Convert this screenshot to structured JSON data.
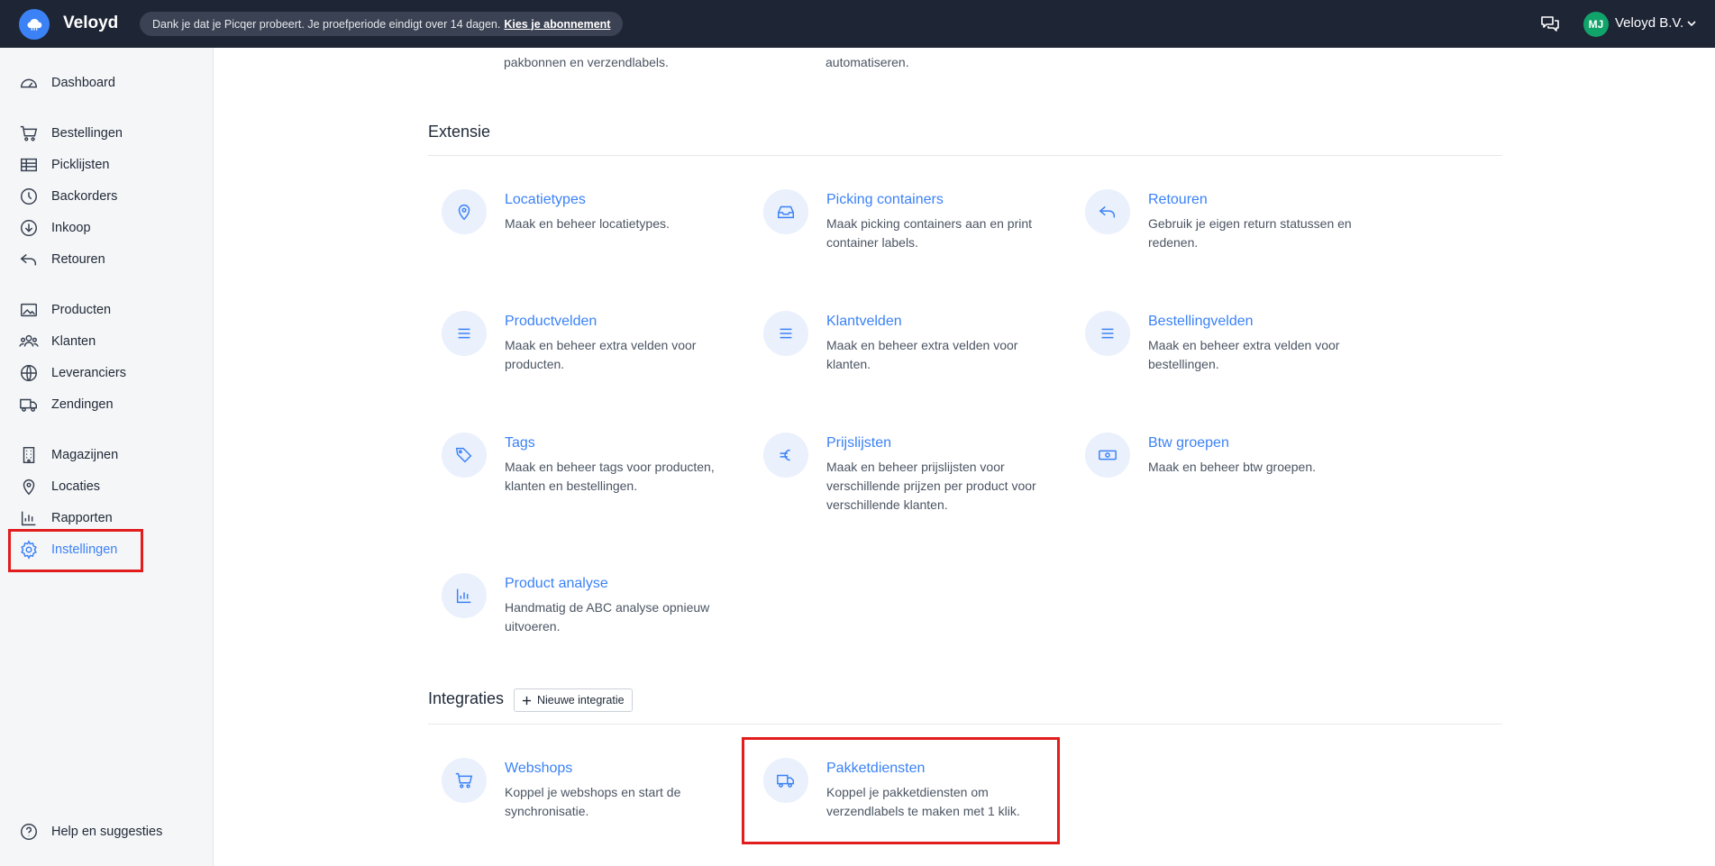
{
  "topbar": {
    "brand": "Veloyd",
    "trial_text": "Dank je dat je Picqer probeert. Je proefperiode eindigt over 14 dagen.",
    "trial_link": "Kies je abonnement",
    "avatar_initials": "MJ",
    "company": "Veloyd B.V."
  },
  "sidebar": {
    "items": [
      {
        "label": "Dashboard",
        "icon": "dashboard-icon"
      },
      {
        "label": "Bestellingen",
        "icon": "cart-icon"
      },
      {
        "label": "Picklijsten",
        "icon": "table-icon"
      },
      {
        "label": "Backorders",
        "icon": "clock-icon"
      },
      {
        "label": "Inkoop",
        "icon": "download-circle-icon"
      },
      {
        "label": "Retouren",
        "icon": "return-icon"
      },
      {
        "label": "Producten",
        "icon": "image-icon"
      },
      {
        "label": "Klanten",
        "icon": "users-icon"
      },
      {
        "label": "Leveranciers",
        "icon": "globe-icon"
      },
      {
        "label": "Zendingen",
        "icon": "truck-icon"
      },
      {
        "label": "Magazijnen",
        "icon": "building-icon"
      },
      {
        "label": "Locaties",
        "icon": "map-pin-icon"
      },
      {
        "label": "Rapporten",
        "icon": "bar-chart-icon"
      },
      {
        "label": "Instellingen",
        "icon": "gear-icon",
        "active": true
      }
    ],
    "help": "Help en suggesties"
  },
  "top_partial": {
    "col1": [
      "pakbonnen en verzendlabels."
    ],
    "col2": [
      "automatiseren."
    ]
  },
  "extensie": {
    "title": "Extensie",
    "cards": [
      {
        "title": "Locatietypes",
        "desc": "Maak en beheer locatietypes.",
        "icon": "map-pin-icon"
      },
      {
        "title": "Picking containers",
        "desc": "Maak picking containers aan en print container labels.",
        "icon": "inbox-icon"
      },
      {
        "title": "Retouren",
        "desc": "Gebruik je eigen return statussen en redenen.",
        "icon": "return-icon"
      },
      {
        "title": "Productvelden",
        "desc": "Maak en beheer extra velden voor producten.",
        "icon": "list-icon"
      },
      {
        "title": "Klantvelden",
        "desc": "Maak en beheer extra velden voor klanten.",
        "icon": "list-icon"
      },
      {
        "title": "Bestellingvelden",
        "desc": "Maak en beheer extra velden voor bestellingen.",
        "icon": "list-icon"
      },
      {
        "title": "Tags",
        "desc": "Maak en beheer tags voor producten, klanten en bestellingen.",
        "icon": "tag-icon"
      },
      {
        "title": "Prijslijsten",
        "desc": "Maak en beheer prijslijsten voor verschillende prijzen per product voor verschillende klanten.",
        "icon": "euro-icon"
      },
      {
        "title": "Btw groepen",
        "desc": "Maak en beheer btw groepen.",
        "icon": "banknote-icon"
      },
      {
        "title": "Product analyse",
        "desc": "Handmatig de ABC analyse opnieuw uitvoeren.",
        "icon": "bar-chart-icon"
      }
    ]
  },
  "integraties": {
    "title": "Integraties",
    "new_button": "Nieuwe integratie",
    "cards": [
      {
        "title": "Webshops",
        "desc": "Koppel je webshops en start de synchronisatie.",
        "icon": "cart-icon"
      },
      {
        "title": "Pakketdiensten",
        "desc": "Koppel je pakketdiensten om verzendlabels te maken met 1 klik.",
        "icon": "truck-icon"
      }
    ]
  }
}
